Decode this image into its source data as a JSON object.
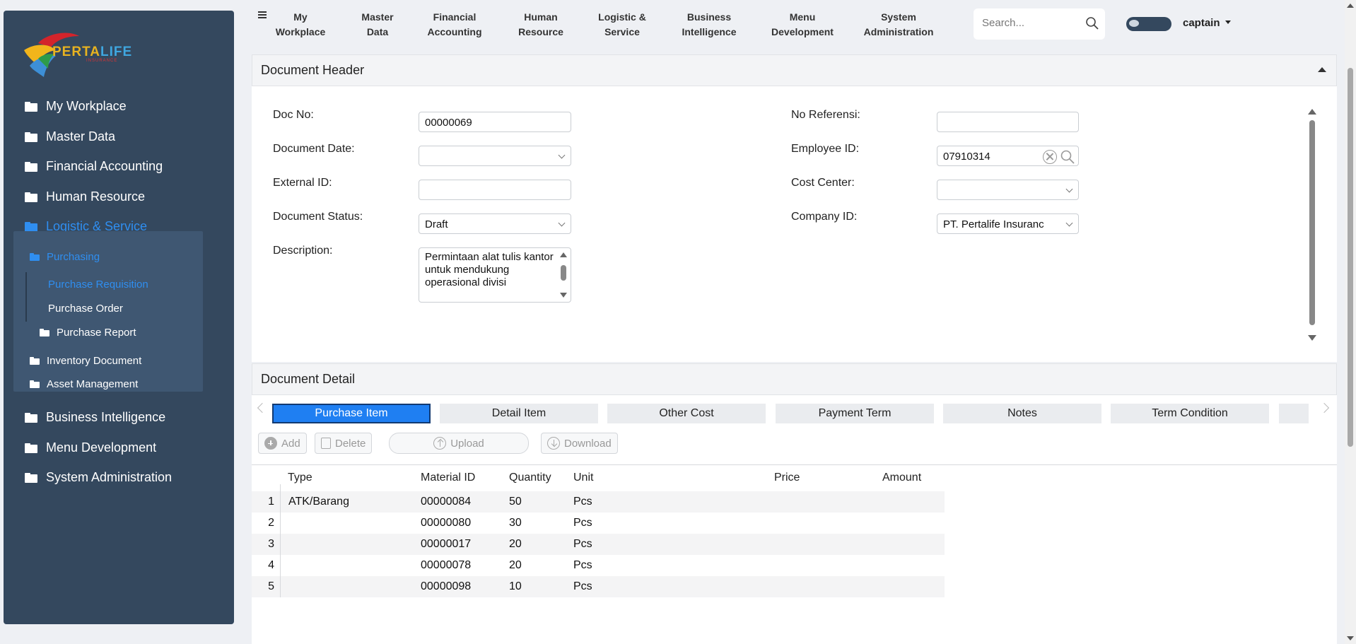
{
  "sidebar": {
    "logo": {
      "brand_a": "PERTA",
      "brand_b": "LIFE",
      "tagline": "INSURANCE"
    },
    "items": [
      {
        "label": "My Workplace"
      },
      {
        "label": "Master Data"
      },
      {
        "label": "Financial Accounting"
      },
      {
        "label": "Human Resource"
      },
      {
        "label": "Logistic & Service"
      },
      {
        "label": "Business Intelligence"
      },
      {
        "label": "Menu Development"
      },
      {
        "label": "System Administration"
      }
    ],
    "sub": {
      "purchasing": "Purchasing",
      "purchase_requisition": "Purchase Requisition",
      "purchase_order": "Purchase Order",
      "purchase_report": "Purchase Report",
      "inventory_document": "Inventory Document",
      "asset_management": "Asset Management"
    }
  },
  "topbar": {
    "menus": [
      {
        "l1": "My",
        "l2": "Workplace"
      },
      {
        "l1": "Master",
        "l2": "Data"
      },
      {
        "l1": "Financial",
        "l2": "Accounting"
      },
      {
        "l1": "Human",
        "l2": "Resource"
      },
      {
        "l1": "Logistic &",
        "l2": "Service"
      },
      {
        "l1": "Business",
        "l2": "Intelligence"
      },
      {
        "l1": "Menu",
        "l2": "Development"
      },
      {
        "l1": "System",
        "l2": "Administration"
      }
    ],
    "search_placeholder": "Search...",
    "user": "captain"
  },
  "header": {
    "title": "Document Header",
    "labels": {
      "doc_no": "Doc No:",
      "document_date": "Document Date:",
      "external_id": "External ID:",
      "document_status": "Document Status:",
      "description": "Description:",
      "no_referensi": "No Referensi:",
      "employee_id": "Employee ID:",
      "cost_center": "Cost Center:",
      "company_id": "Company ID:"
    },
    "values": {
      "doc_no": "00000069",
      "document_date": "",
      "external_id": "",
      "document_status": "Draft",
      "description": "Permintaan alat tulis kantor untuk mendukung operasional divisi",
      "no_referensi": "",
      "employee_id": "07910314",
      "cost_center": "",
      "company_id": "PT. Pertalife Insuranc"
    }
  },
  "detail": {
    "title": "Document Detail",
    "tabs": [
      "Purchase Item",
      "Detail Item",
      "Other Cost",
      "Payment Term",
      "Notes",
      "Term Condition"
    ],
    "toolbar": {
      "add": "Add",
      "delete": "Delete",
      "upload": "Upload",
      "download": "Download"
    },
    "columns": [
      "Type",
      "Material ID",
      "Quantity",
      "Unit",
      "Price",
      "Amount"
    ],
    "rows": [
      {
        "no": "1",
        "type": "ATK/Barang",
        "material_id": "00000084",
        "quantity": "50",
        "unit": "Pcs",
        "price": "",
        "amount": ""
      },
      {
        "no": "2",
        "type": "",
        "material_id": "00000080",
        "quantity": "30",
        "unit": "Pcs",
        "price": "",
        "amount": ""
      },
      {
        "no": "3",
        "type": "",
        "material_id": "00000017",
        "quantity": "20",
        "unit": "Pcs",
        "price": "",
        "amount": ""
      },
      {
        "no": "4",
        "type": "",
        "material_id": "00000078",
        "quantity": "20",
        "unit": "Pcs",
        "price": "",
        "amount": ""
      },
      {
        "no": "5",
        "type": "",
        "material_id": "00000098",
        "quantity": "10",
        "unit": "Pcs",
        "price": "",
        "amount": ""
      }
    ]
  },
  "colors": {
    "sidebar_bg": "#34485e",
    "accent": "#1f7ff2",
    "active_text": "#2f8ef0"
  }
}
